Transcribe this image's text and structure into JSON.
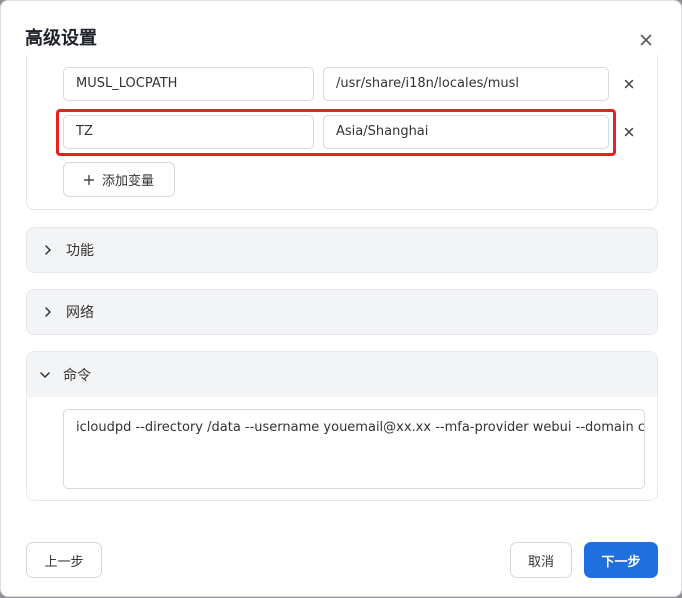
{
  "dialog": {
    "title": "高级设置"
  },
  "env": {
    "rows": [
      {
        "key": "MUSL_LOCPATH",
        "value": "/usr/share/i18n/locales/musl"
      },
      {
        "key": "TZ",
        "value": "Asia/Shanghai"
      }
    ],
    "add_label": "添加变量"
  },
  "panels": {
    "features": {
      "label": "功能",
      "expanded": false
    },
    "network": {
      "label": "网络",
      "expanded": false
    },
    "command": {
      "label": "命令",
      "expanded": true,
      "value": "icloudpd --directory /data --username youemail@xx.xx --mfa-provider webui --domain cn"
    }
  },
  "footer": {
    "prev_label": "上一步",
    "cancel_label": "取消",
    "next_label": "下一步"
  },
  "colors": {
    "primary": "#1f6fe0",
    "highlight": "#e8231f"
  },
  "icons": {
    "close": "close-icon",
    "remove": "close-icon",
    "add": "plus-icon",
    "collapsed": "chevron-right-icon",
    "expanded": "chevron-down-icon"
  }
}
